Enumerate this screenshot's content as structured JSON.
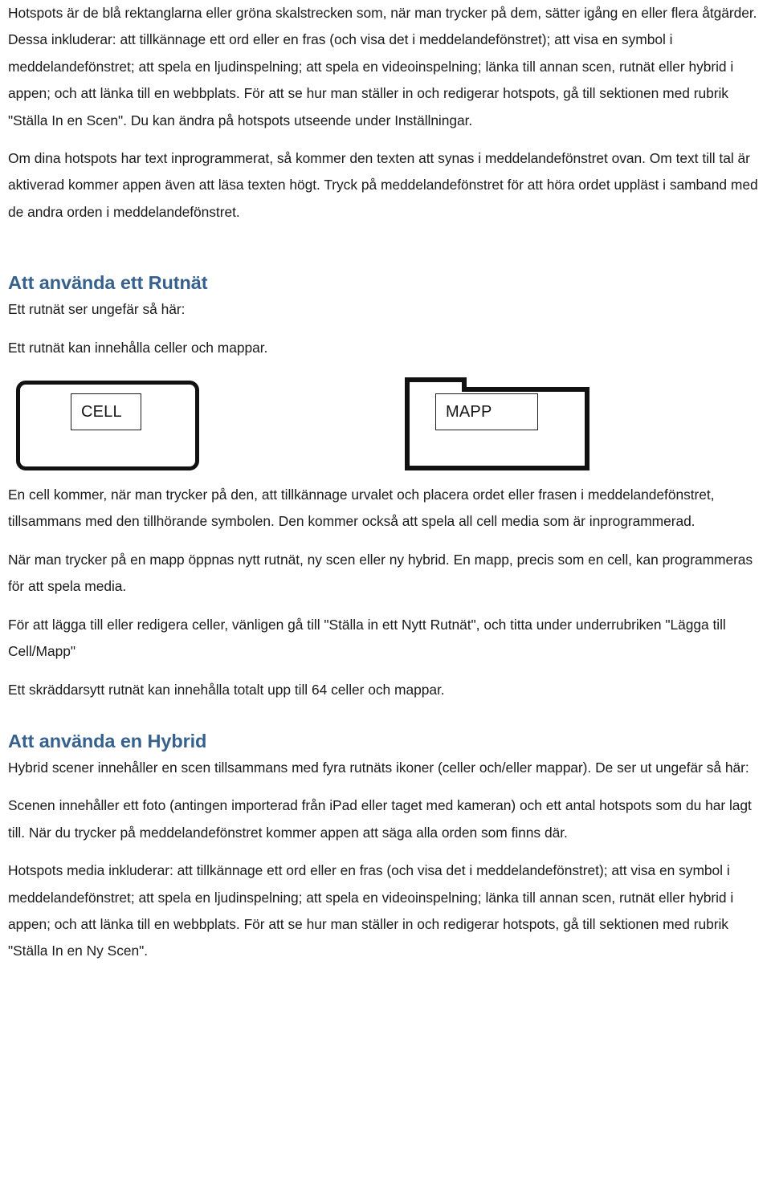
{
  "document": {
    "language": "sv",
    "heading_color": "#36618e",
    "body_color": "#1b1b1b",
    "paragraphs": {
      "p1": "Hotspots är de blå rektanglarna eller gröna skalstrecken som, när man trycker på dem, sätter igång en eller flera åtgärder. Dessa inkluderar: att tillkännage ett ord eller en fras (och visa det i meddelandefönstret); att visa en symbol i meddelandefönstret; att spela en ljudinspelning; att spela en videoinspelning; länka till annan scen, rutnät eller hybrid i appen; och att länka till en webbplats. För att se hur man ställer in och redigerar hotspots, gå till sektionen med rubrik \"Ställa In en Scen\". Du kan ändra på hotspots utseende under Inställningar.",
      "p2": "Om dina hotspots har text inprogrammerat, så kommer den texten att synas i meddelandefönstret ovan. Om text till tal är aktiverad kommer appen även att läsa texten högt. Tryck på meddelandefönstret för att höra ordet uppläst i samband med de andra orden i meddelandefönstret.",
      "p3": "Ett rutnät ser ungefär så här:",
      "p4": "Ett rutnät kan innehålla celler och mappar.",
      "p5": "En cell kommer, när man trycker på den, att tillkännage urvalet och placera ordet eller frasen i meddelandefönstret, tillsammans med den tillhörande symbolen. Den kommer också att spela all cell media som är inprogrammerad.",
      "p6": "När man trycker på en mapp öppnas nytt rutnät, ny scen eller ny hybrid. En mapp, precis som en cell, kan programmeras för att spela media.",
      "p7": "För att lägga till eller redigera celler, vänligen gå till \"Ställa in ett Nytt Rutnät\", och titta under underrubriken \"Lägga till Cell/Mapp\"",
      "p8": "Ett skräddarsytt rutnät kan innehålla totalt upp till 64 celler och mappar.",
      "p9": "Hybrid scener innehåller en scen tillsammans med fyra rutnäts ikoner (celler och/eller mappar). De ser ut ungefär så här:",
      "p10": "Scenen innehåller ett foto (antingen importerad från iPad eller taget med kameran) och ett antal hotspots som du har lagt till. När du trycker på meddelandefönstret kommer appen att säga alla orden som finns där.",
      "p11": "Hotspots media inkluderar: att tillkännage ett ord eller en fras (och visa det i meddelandefönstret); att visa en symbol i meddelandefönstret; att spela en ljudinspelning; att spela en videoinspelning; länka till annan scen, rutnät eller hybrid i appen; och att länka till en webbplats. För att se hur man ställer in och redigerar hotspots, gå till sektionen med rubrik \"Ställa In en Ny Scen\"."
    },
    "headings": {
      "h1": "Att använda ett Rutnät",
      "h2": "Att använda en Hybrid"
    },
    "diagram": {
      "cell_label": "CELL",
      "mapp_label": "MAPP"
    }
  }
}
